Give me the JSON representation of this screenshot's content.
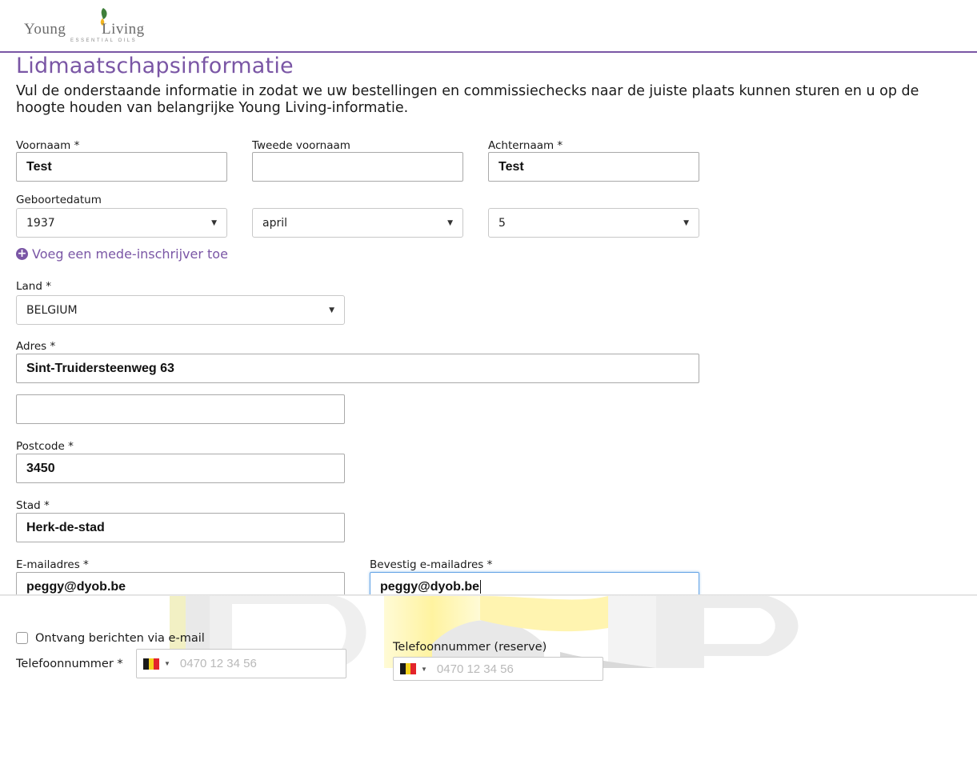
{
  "brand": {
    "logo_text_left": "Young",
    "logo_text_right": "Living",
    "logo_subtitle": "ESSENTIAL OILS",
    "accent_color": "#7a56a5"
  },
  "page": {
    "title": "Lidmaatschapsinformatie",
    "intro": "Vul de onderstaande informatie in zodat we uw bestellingen en commissiechecks naar de juiste plaats kunnen sturen en u op de hoogte houden van belangrijke Young Living-informatie."
  },
  "form": {
    "first_name": {
      "label": "Voornaam *",
      "value": "Test"
    },
    "middle_name": {
      "label": "Tweede voornaam",
      "value": ""
    },
    "last_name": {
      "label": "Achternaam *",
      "value": "Test"
    },
    "birthdate": {
      "label": "Geboortedatum",
      "year": "1937",
      "month": "april",
      "day": "5"
    },
    "add_coapplicant": {
      "label": "Voeg een mede-inschrijver toe",
      "icon": "plus-circle-icon"
    },
    "country": {
      "label": "Land *",
      "value": "BELGIUM"
    },
    "address": {
      "label": "Adres *",
      "line1": "Sint-Truidersteenweg 63",
      "line2": ""
    },
    "postcode": {
      "label": "Postcode *",
      "value": "3450"
    },
    "city": {
      "label": "Stad *",
      "value": "Herk-de-stad"
    },
    "email": {
      "label": "E-mailadres *",
      "value": "peggy@dyob.be"
    },
    "email_confirm": {
      "label": "Bevestig e-mailadres *",
      "value": "peggy@dyob.be"
    },
    "email_opt_in": {
      "label": "Ontvang berichten via e-mail",
      "checked": false
    },
    "phone": {
      "label": "Telefoonnummer *",
      "placeholder": "0470 12 34 56",
      "country_flag": "belgium-flag-icon"
    },
    "phone_backup": {
      "label": "Telefoonnummer (reserve)",
      "placeholder": "0470 12 34 56",
      "country_flag": "belgium-flag-icon"
    }
  },
  "colors": {
    "flag_black": "#1a1a1a",
    "flag_yellow": "#f4d21f",
    "flag_red": "#e3242b"
  }
}
